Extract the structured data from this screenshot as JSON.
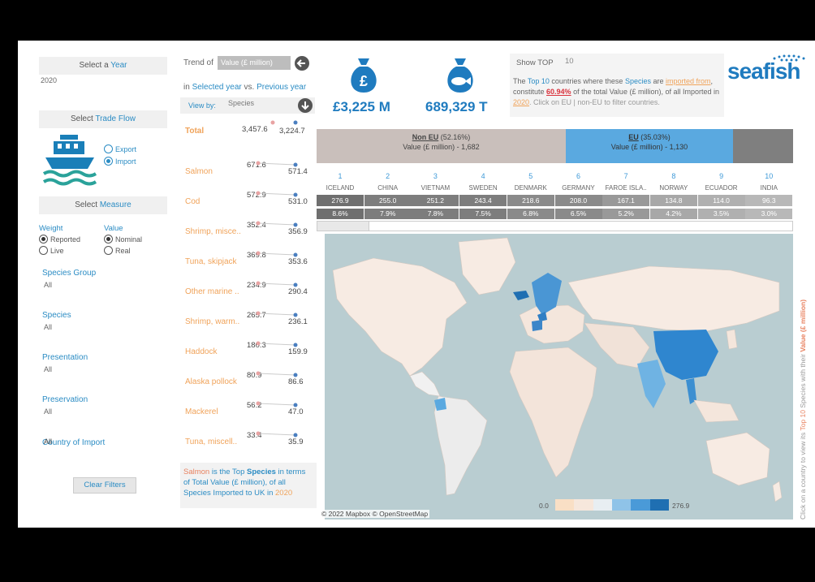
{
  "filters": {
    "year_header_prefix": "Select a ",
    "year_header_keyword": "Year",
    "year_value": "2020",
    "trade_header_prefix": "Select ",
    "trade_header_keyword": "Trade Flow",
    "export_label": "Export",
    "import_label": "Import",
    "measure_header_prefix": "Select ",
    "measure_header_keyword": "Measure",
    "weight_label": "Weight",
    "value_label": "Value",
    "reported_label": "Reported",
    "live_label": "Live",
    "nominal_label": "Nominal",
    "real_label": "Real",
    "species_group_label": "Species Group",
    "species_group_value": "All",
    "species_label": "Species",
    "species_value": "All",
    "presentation_label": "Presentation",
    "presentation_value": "All",
    "preservation_label": "Preservation",
    "preservation_value": "All",
    "country_label": "Country of Import",
    "country_value": "All",
    "clear_button": "Clear Filters"
  },
  "trend": {
    "title_prefix": "Trend of",
    "measure_select": "Value (£ million)",
    "subtitle_part1": "in ",
    "subtitle_part2": "Selected year",
    "subtitle_part3": " vs. ",
    "subtitle_part4": "Previous year",
    "viewby_label": "View by:",
    "viewby_value": "Species",
    "total_label": "Total",
    "total_prev": "3,457.6",
    "total_cur": "3,224.7",
    "rows": [
      {
        "name": "Salmon",
        "prev": "671.6",
        "cur": "571.4"
      },
      {
        "name": "Cod",
        "prev": "572.9",
        "cur": "531.0"
      },
      {
        "name": "Shrimp, misce..",
        "prev": "352.4",
        "cur": "356.9"
      },
      {
        "name": "Tuna, skipjack",
        "prev": "369.8",
        "cur": "353.6"
      },
      {
        "name": "Other marine ..",
        "prev": "234.9",
        "cur": "290.4"
      },
      {
        "name": "Shrimp, warm..",
        "prev": "265.7",
        "cur": "236.1"
      },
      {
        "name": "Haddock",
        "prev": "180.3",
        "cur": "159.9"
      },
      {
        "name": "Alaska pollock",
        "prev": "80.9",
        "cur": "86.6"
      },
      {
        "name": "Mackerel",
        "prev": "56.2",
        "cur": "47.0"
      },
      {
        "name": "Tuna, miscell..",
        "prev": "33.4",
        "cur": "35.9"
      }
    ],
    "summary_species": "Salmon",
    "summary_part1": " is the Top ",
    "summary_kw": "Species",
    "summary_part2": " in terms of Total Value (£ million), of all Species Imported to UK in ",
    "summary_year": "2020"
  },
  "kpi": {
    "value": "£3,225 M",
    "tonnes": "689,329 T"
  },
  "top": {
    "label": "Show TOP",
    "value": "10",
    "desc_1": "The ",
    "desc_top": "Top 10",
    "desc_2": " countries where these ",
    "desc_species": "Species",
    "desc_3": " are ",
    "desc_imported": "imported from",
    "desc_4": ", constitute ",
    "desc_pct": "60.94%",
    "desc_5": " of the total Value (£ million), of all Imported in ",
    "desc_year": "2020",
    "desc_6": ". Click on EU | non-EU to filter countries."
  },
  "brand": {
    "logo": "seafish"
  },
  "eu_bar": {
    "non_eu_label": "Non EU",
    "non_eu_pct": " (52.16%)",
    "non_eu_value": "Value (£ million) - 1,682",
    "eu_label": "EU",
    "eu_pct": " (35.03%)",
    "eu_value": "Value (£ million) - 1,130"
  },
  "countries": [
    {
      "rank": "1",
      "name": "ICELAND",
      "value": "276.9",
      "pct": "8.6%"
    },
    {
      "rank": "2",
      "name": "CHINA",
      "value": "255.0",
      "pct": "7.9%"
    },
    {
      "rank": "3",
      "name": "VIETNAM",
      "value": "251.2",
      "pct": "7.8%"
    },
    {
      "rank": "4",
      "name": "SWEDEN",
      "value": "243.4",
      "pct": "7.5%"
    },
    {
      "rank": "5",
      "name": "DENMARK",
      "value": "218.6",
      "pct": "6.8%"
    },
    {
      "rank": "6",
      "name": "GERMANY",
      "value": "208.0",
      "pct": "6.5%"
    },
    {
      "rank": "7",
      "name": "FAROE ISLA..",
      "value": "167.1",
      "pct": "5.2%"
    },
    {
      "rank": "8",
      "name": "NORWAY",
      "value": "134.8",
      "pct": "4.2%"
    },
    {
      "rank": "9",
      "name": "ECUADOR",
      "value": "114.0",
      "pct": "3.5%"
    },
    {
      "rank": "10",
      "name": "INDIA",
      "value": "96.3",
      "pct": "3.0%"
    }
  ],
  "map": {
    "legend_min": "0.0",
    "legend_max": "276.9",
    "attribution": "© 2022 Mapbox © OpenStreetMap",
    "side_text_1": "Click on a country to view its ",
    "side_text_top": "Top 10",
    "side_text_2": " Species with their ",
    "side_text_value": "Value (£ million)"
  },
  "colors": {
    "accent": "#2b8cc4",
    "kpi": "#1f7bbf",
    "noneu": "#c9bfbb",
    "eu": "#5aa9e0",
    "ocean": "#b9cdd1"
  }
}
